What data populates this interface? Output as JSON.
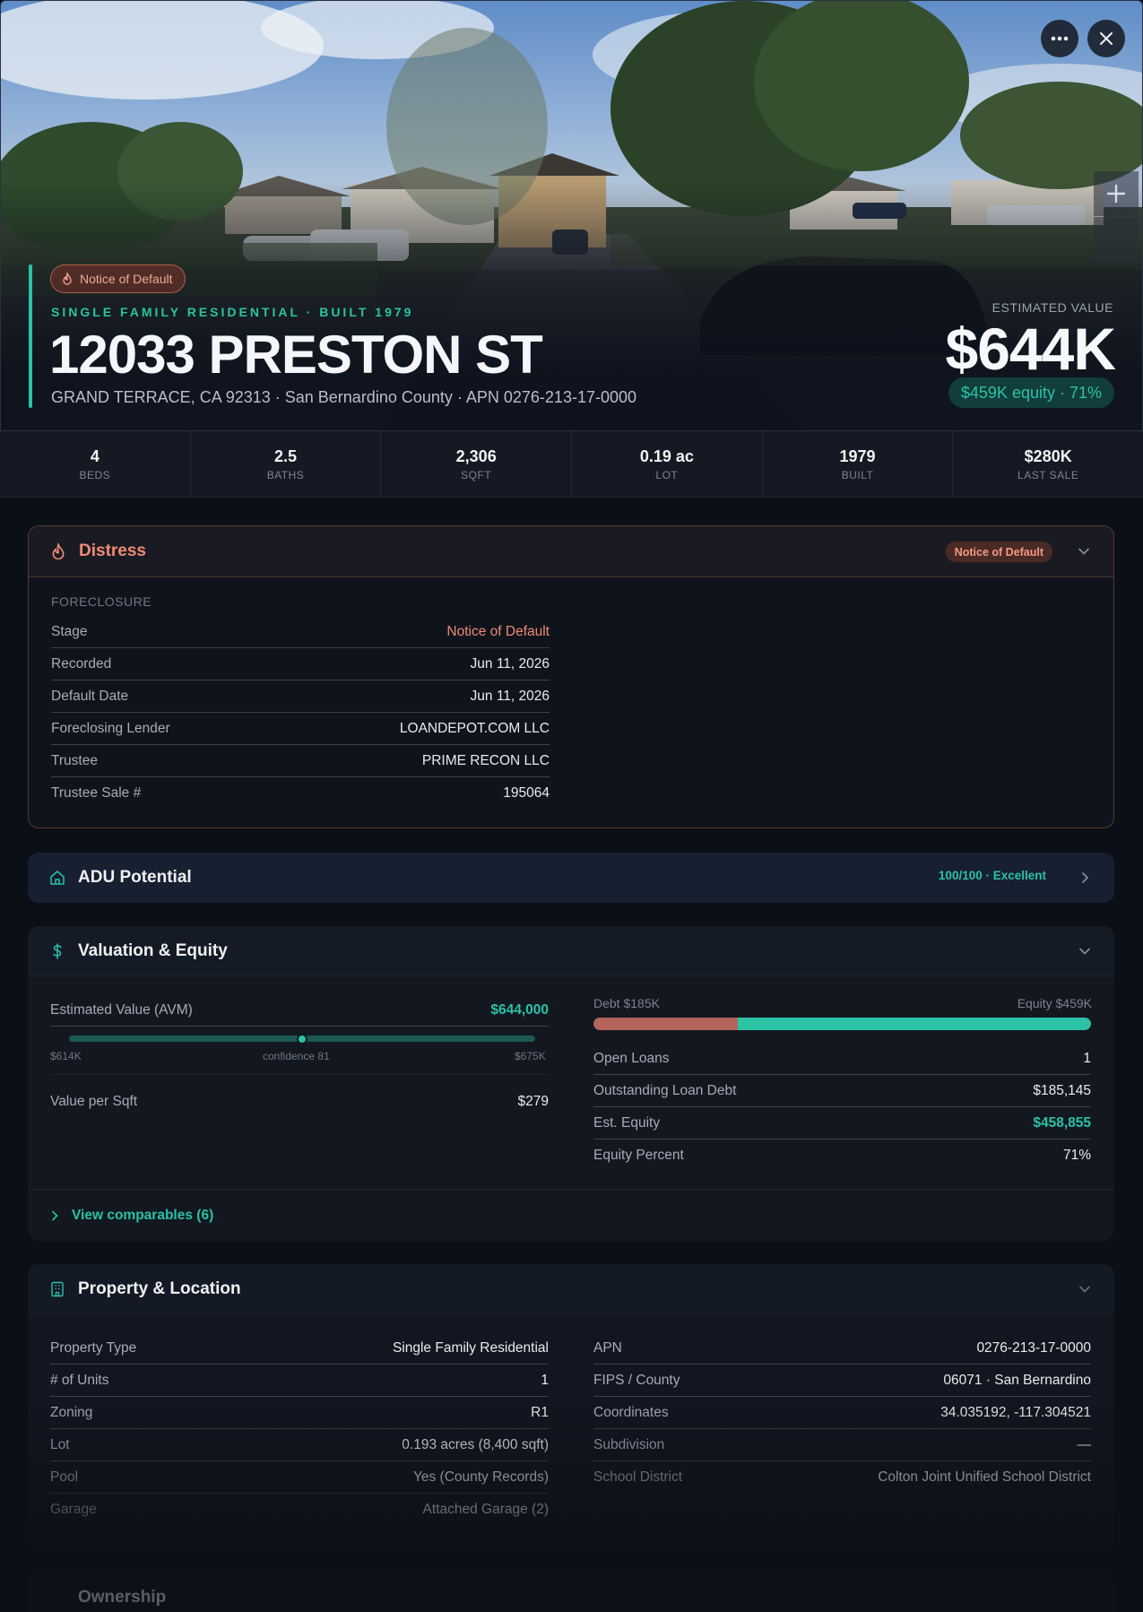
{
  "hero": {
    "distress_badge": "Notice of Default",
    "type_line": "SINGLE FAMILY RESIDENTIAL · BUILT 1979",
    "street": "12033 PRESTON ST",
    "subline": "GRAND TERRACE, CA 92313 · San Bernardino County · APN 0276-213-17-0000",
    "value_label": "ESTIMATED VALUE",
    "value": "$644K",
    "equity_pill": "$459K equity · 71%"
  },
  "stats": [
    {
      "value": "4",
      "label": "BEDS"
    },
    {
      "value": "2.5",
      "label": "BATHS"
    },
    {
      "value": "2,306",
      "label": "SQFT"
    },
    {
      "value": "0.19 ac",
      "label": "LOT"
    },
    {
      "value": "1979",
      "label": "BUILT"
    },
    {
      "value": "$280K",
      "label": "LAST SALE"
    }
  ],
  "distress": {
    "title": "Distress",
    "badge": "Notice of Default",
    "section": "FORECLOSURE",
    "rows": [
      {
        "k": "Stage",
        "v": "Notice of Default"
      },
      {
        "k": "Recorded",
        "v": "Jun 11, 2026"
      },
      {
        "k": "Default Date",
        "v": "Jun 11, 2026"
      },
      {
        "k": "Foreclosing Lender",
        "v": "LOANDEPOT.COM LLC"
      },
      {
        "k": "Trustee",
        "v": "PRIME RECON LLC"
      },
      {
        "k": "Trustee Sale #",
        "v": "195064"
      }
    ]
  },
  "adu": {
    "title": "ADU Potential",
    "score": "100/100 · Excellent"
  },
  "valuation": {
    "title": "Valuation & Equity",
    "avm_label": "Estimated Value (AVM)",
    "avm_value": "$644,000",
    "range_low": "$614K",
    "range_mid": "confidence 81",
    "range_high": "$675K",
    "confidence_position": 0.5,
    "vpsf_label": "Value per Sqft",
    "vpsf_value": "$279",
    "debt_label": "Debt $185K",
    "equity_label": "Equity $459K",
    "debt_fraction": 0.29,
    "rows": [
      {
        "k": "Open Loans",
        "v": "1"
      },
      {
        "k": "Outstanding Loan Debt",
        "v": "$185,145"
      },
      {
        "k": "Est. Equity",
        "v": "$458,855"
      },
      {
        "k": "Equity Percent",
        "v": "71%"
      }
    ],
    "comps_link": "View comparables (6)"
  },
  "property": {
    "title": "Property & Location",
    "left": [
      {
        "k": "Property Type",
        "v": "Single Family Residential"
      },
      {
        "k": "# of Units",
        "v": "1"
      },
      {
        "k": "Zoning",
        "v": "R1"
      },
      {
        "k": "Lot",
        "v": "0.193 acres (8,400 sqft)"
      },
      {
        "k": "Pool",
        "v": "Yes (County Records)"
      },
      {
        "k": "Garage",
        "v": "Attached Garage (2)"
      }
    ],
    "right": [
      {
        "k": "APN",
        "v": "0276-213-17-0000"
      },
      {
        "k": "FIPS / County",
        "v": "06071 · San Bernardino"
      },
      {
        "k": "Coordinates",
        "v": "34.035192, -117.304521"
      },
      {
        "k": "Subdivision",
        "v": "—"
      },
      {
        "k": "School District",
        "v": "Colton Joint Unified School District"
      }
    ]
  },
  "ownership": {
    "title": "Ownership"
  },
  "colors": {
    "accent": "#2bc2a6",
    "distress": "#f08a76",
    "debt": "#b4645a",
    "background": "#0b0f16"
  }
}
